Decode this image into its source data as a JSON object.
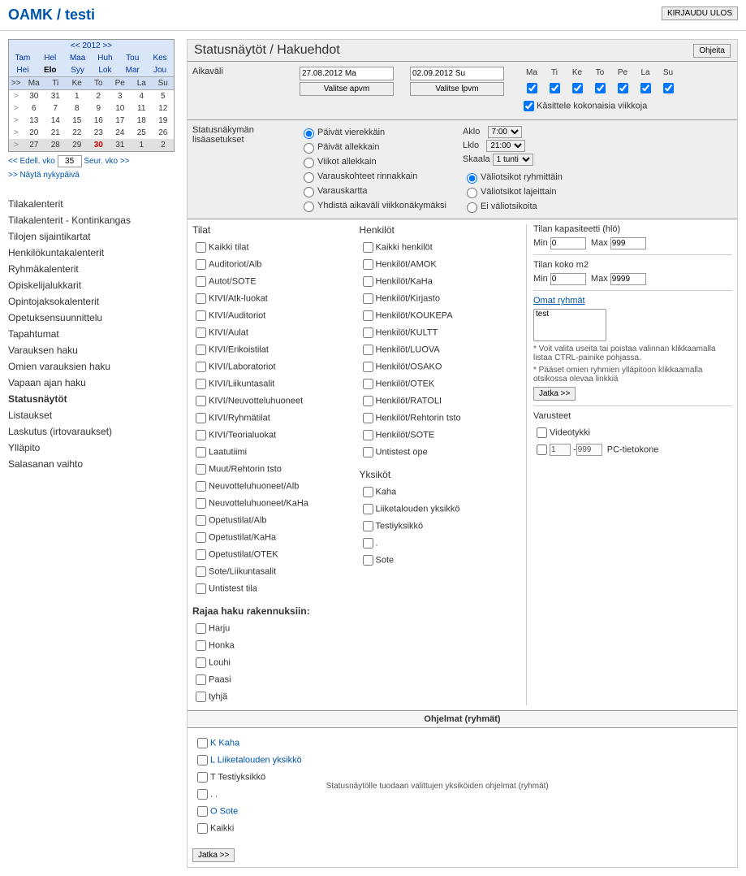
{
  "brand": "OAMK / testi",
  "logout": "KIRJAUDU ULOS",
  "cal": {
    "year": "2012",
    "prev": "<<",
    "next": ">>",
    "months1": [
      "Tam",
      "Hel",
      "Maa",
      "Huh",
      "Tou",
      "Kes"
    ],
    "months2": [
      "Hei",
      "Elo",
      "Syy",
      "Lok",
      "Mar",
      "Jou"
    ],
    "curMonth": "Elo",
    "hdr": [
      ">>",
      "Ma",
      "Ti",
      "Ke",
      "To",
      "Pe",
      "La",
      "Su"
    ],
    "rows": [
      [
        ">",
        "30",
        "31",
        "1",
        "2",
        "3",
        "4",
        "5"
      ],
      [
        ">",
        "6",
        "7",
        "8",
        "9",
        "10",
        "11",
        "12"
      ],
      [
        ">",
        "13",
        "14",
        "15",
        "16",
        "17",
        "18",
        "19"
      ],
      [
        ">",
        "20",
        "21",
        "22",
        "23",
        "24",
        "25",
        "26"
      ],
      [
        ">",
        "27",
        "28",
        "29",
        "30",
        "31",
        "1",
        "2"
      ]
    ],
    "todayIdx": "30",
    "edell": "<< Edell. vko",
    "wk": "35",
    "seur": "Seur. vko >>",
    "nyky": ">> Näytä nykypäivä"
  },
  "nav": [
    "Tilakalenterit",
    "Tilakalenterit - Kontinkangas",
    "Tilojen sijaintikartat",
    "Henkilökuntakalenterit",
    "Ryhmäkalenterit",
    "Opiskelijalukkarit",
    "Opintojaksokalenterit",
    "Opetuksensuunnittelu",
    "Tapahtumat",
    "Varauksen haku",
    "Omien varauksien haku",
    "Vapaan ajan haku",
    "Statusnäytöt",
    "Listaukset",
    "Laskutus (irtovaraukset)",
    "Ylläpito",
    "Salasanan vaihto"
  ],
  "navCur": "Statusnäytöt",
  "title": "Statusnäytöt / Hakuehdot",
  "help": "Ohjeita",
  "s1": {
    "label": "Aikaväli",
    "apvm": "27.08.2012 Ma",
    "lpvm": "02.09.2012 Su",
    "btna": "Valitse apvm",
    "btnl": "Valitse lpvm",
    "days": [
      "Ma",
      "Ti",
      "Ke",
      "To",
      "Pe",
      "La",
      "Su"
    ],
    "whole": "Käsittele kokonaisia viikkoja"
  },
  "s2": {
    "label": "Statusnäkymän lisäasetukset",
    "radios": [
      "Päivät vierekkäin",
      "Päivät allekkain",
      "Viikot allekkain",
      "Varauskohteet rinnakkain",
      "Varauskartta",
      "Yhdistä aikaväli viikkonäkymäksi"
    ],
    "aklo": "Aklo",
    "akloV": "7:00",
    "lklo": "Lklo",
    "lkloV": "21:00",
    "skaala": "Skaala",
    "skaalaV": "1 tunti",
    "r2": [
      "Väliotsikot ryhmittäin",
      "Väliotsikot lajeittain",
      "Ei väliotsikoita"
    ]
  },
  "tilat": {
    "h": "Tilat",
    "items": [
      "Kaikki tilat",
      "Auditoriot/Alb",
      "Autot/SOTE",
      "KIVI/Atk-luokat",
      "KIVI/Auditoriot",
      "KIVI/Aulat",
      "KIVI/Erikoistilat",
      "KIVI/Laboratoriot",
      "KIVI/Liikuntasalit",
      "KIVI/Neuvotteluhuoneet",
      "KIVI/Ryhmätilat",
      "KIVI/Teorialuokat",
      "Laatutiimi",
      "Muut/Rehtorin tsto",
      "Neuvotteluhuoneet/Alb",
      "Neuvotteluhuoneet/KaHa",
      "Opetustilat/Alb",
      "Opetustilat/KaHa",
      "Opetustilat/OTEK",
      "Sote/Liikuntasalit",
      "Untistest tila"
    ]
  },
  "rajaa": {
    "h": "Rajaa haku rakennuksiin:",
    "items": [
      "Harju",
      "Honka",
      "Louhi",
      "Paasi",
      "tyhjä"
    ]
  },
  "henk": {
    "h": "Henkilöt",
    "items": [
      "Kaikki henkilöt",
      "Henkilöt/AMOK",
      "Henkilöt/KaHa",
      "Henkilöt/Kirjasto",
      "Henkilöt/KOUKEPA",
      "Henkilöt/KULTT",
      "Henkilöt/LUOVA",
      "Henkilöt/OSAKO",
      "Henkilöt/OTEK",
      "Henkilöt/RATOLI",
      "Henkilöt/Rehtorin tsto",
      "Henkilöt/SOTE",
      "Untistest ope"
    ]
  },
  "yks": {
    "h": "Yksiköt",
    "items": [
      "Kaha",
      "Liiketalouden yksikkö",
      "Testiyksikkö",
      ".",
      "Sote"
    ]
  },
  "kap": {
    "h": "Tilan kapasiteetti (hlö)",
    "min": "Min",
    "minV": "0",
    "max": "Max",
    "maxV": "999"
  },
  "koko": {
    "h": "Tilan koko m2",
    "min": "Min",
    "minV": "0",
    "max": "Max",
    "maxV": "9999"
  },
  "omat": {
    "h": "Omat ryhmät",
    "opt": "test",
    "n1": "* Voit valita useita tai poistaa valinnan klikkaamalla listaa CTRL-painike pohjassa.",
    "n2": "* Pääset omien ryhmien ylläpitoon klikkaamalla otsikossa olevaa linkkiä",
    "btn": "Jatka >>"
  },
  "var": {
    "h": "Varusteet",
    "v1": "Videotykki",
    "v2": "PC-tietokone",
    "v2a": "1",
    "v2b": "999"
  },
  "ohj": {
    "h": "Ohjelmat (ryhmät)",
    "items": [
      {
        "c": "K",
        "t": "Kaha",
        "l": true
      },
      {
        "c": "L",
        "t": "Liiketalouden yksikkö",
        "l": true
      },
      {
        "c": "T",
        "t": "Testiyksikkö",
        "l": false
      },
      {
        "c": ".",
        "t": ".",
        "l": false
      },
      {
        "c": "O",
        "t": "Sote",
        "l": true
      },
      {
        "c": "",
        "t": "Kaikki",
        "l": false
      }
    ],
    "note": "Statusnäytölle tuodaan valittujen yksiköiden ohjelmat (ryhmät)"
  },
  "jatka": "Jatka >>"
}
